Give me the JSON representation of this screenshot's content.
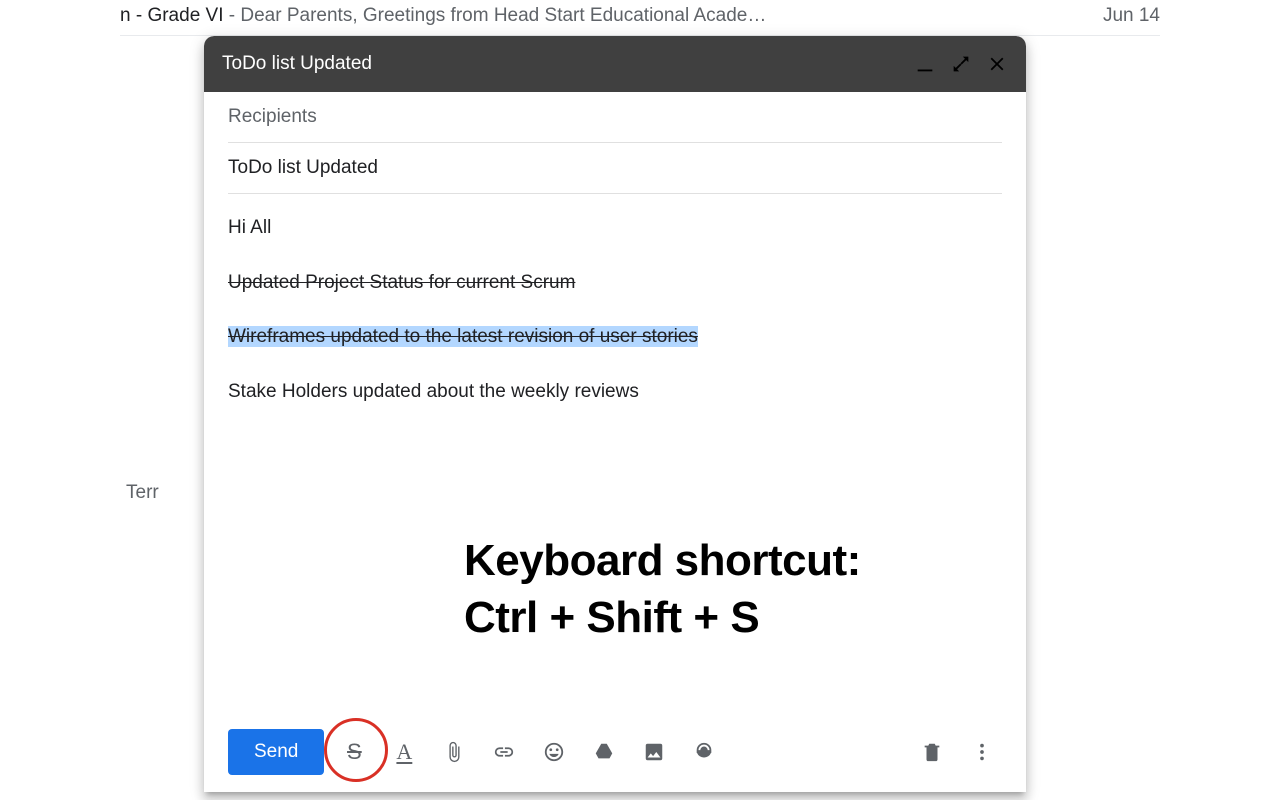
{
  "background": {
    "row": {
      "subject_frag": "n - Grade VI",
      "separator": " - ",
      "snippet": "Dear Parents, Greetings from Head Start Educational Acade…",
      "date": "Jun 14"
    },
    "side_frag": "Terr"
  },
  "compose": {
    "title": "ToDo list Updated",
    "recipients_placeholder": "Recipients",
    "subject": "ToDo list Updated",
    "body": {
      "greeting": "Hi All",
      "line1": "Updated Project Status for current Scrum ",
      "line2": "Wireframes updated to the latest revision of user stories",
      "line3": "Stake Holders updated about the weekly reviews"
    },
    "send_label": "Send",
    "icons": {
      "strike": "S",
      "format": "A"
    }
  },
  "annotation": {
    "line1": "Keyboard shortcut:",
    "line2": "Ctrl + Shift + S"
  }
}
